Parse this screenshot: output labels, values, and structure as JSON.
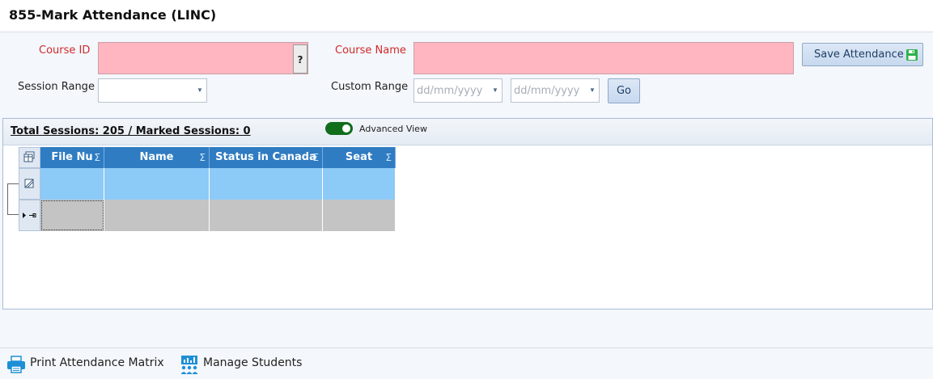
{
  "window": {
    "title": "855-Mark Attendance (LINC)"
  },
  "form": {
    "course_id_label": "Course ID",
    "course_id_value": "",
    "lookup_button": "?",
    "course_name_label": "Course Name",
    "course_name_value": "",
    "session_range_label": "Session Range",
    "session_range_value": "",
    "custom_range_label": "Custom Range",
    "from_date_placeholder": "dd/mm/yyyy",
    "to_date_placeholder": "dd/mm/yyyy",
    "go_button": "Go",
    "save_button": "Save Attendance"
  },
  "summary": {
    "sessions_text": "Total Sessions: 205 / Marked Sessions: 0",
    "advanced_view_label": "Advanced View",
    "advanced_view_on": true
  },
  "grid": {
    "columns": [
      {
        "label": "File Nu",
        "sum": "Σ"
      },
      {
        "label": "Name",
        "sum": "Σ"
      },
      {
        "label": "Status in Canada",
        "sum": "Σ"
      },
      {
        "label": "Seat",
        "sum": "Σ"
      }
    ]
  },
  "bottom": {
    "print_label": "Print Attendance Matrix",
    "manage_label": "Manage Students"
  },
  "colors": {
    "required_label": "#d02a2a",
    "required_field": "#ffb6c1",
    "grid_header": "#2f7cc2",
    "filter_row": "#8ccaf7",
    "new_row": "#c4c4c4",
    "toggle_on": "#0f6d1b",
    "save_icon": "#2db24a"
  }
}
